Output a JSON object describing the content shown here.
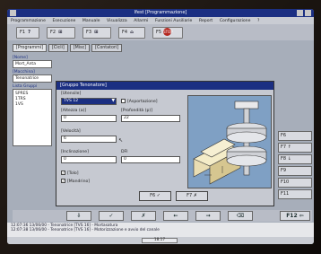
{
  "window": {
    "title": "Ifest [Programmazione]"
  },
  "menu": [
    "Programmazione",
    "Esecuzione",
    "Manuale",
    "Visualizza",
    "Allarmi",
    "Funzioni Ausiliarie",
    "Report",
    "Configurazione",
    "?"
  ],
  "toolbar": [
    {
      "label": "F1",
      "icon": "?"
    },
    {
      "label": "F2",
      "icon": "⊞"
    },
    {
      "label": "F3",
      "icon": "⊞"
    },
    {
      "label": "F4",
      "icon": "⌂"
    },
    {
      "label": "F5",
      "icon": "STOP"
    }
  ],
  "tabs": [
    "[Programmi]",
    "[Cicli]",
    "[Misc]",
    "[Contatori]"
  ],
  "left": {
    "group1": "[Nome]",
    "name_value": "Mort_Anta",
    "group2": "[Macchina]",
    "machine_value": "Tenonatrice",
    "list_label": "Lista Gruppi",
    "list_items": [
      "SPRES",
      "1TRS",
      "1VS"
    ]
  },
  "dialog": {
    "title": "[Gruppo Tenonatore]",
    "utensile_label": "[Utensile]",
    "utensile_value": "TVS 12",
    "asportazione_label": "[Asportazione]",
    "altezza_label": "[Altezza (a)]",
    "altezza_value": "0",
    "profondita_label": "[Profondità (p)]",
    "profondita_value": "22",
    "velocita_label": "[Velocità]",
    "velocita_value": "6",
    "inclinazione_label": "[Inclinazione]",
    "inclinazione_value": "0",
    "dfi_label": "DFI",
    "dfi_value": "0",
    "tolo_label": "[Tolo]",
    "mandrino_label": "[Mandrino]",
    "ok_label": "F6 ✓",
    "cancel_label": "F7 ✗"
  },
  "right_buttons": [
    "F6",
    "F7 ↑",
    "F8 ↓",
    "F9",
    "F10",
    "F11",
    "F12"
  ],
  "bottom_buttons": [
    "⇩",
    "✓",
    "✗",
    "←",
    "→",
    "⌫",
    "F12 ⇦"
  ],
  "status": {
    "line1": "12:07:36 13/06/00 - Tenonatrice [TVS 16] - Mortasatura",
    "line2": "12:07:38 13/06/00 - Tenonatrice [TVS 16] - Motorizzazione e avvio del canale"
  },
  "clock": "18.17"
}
